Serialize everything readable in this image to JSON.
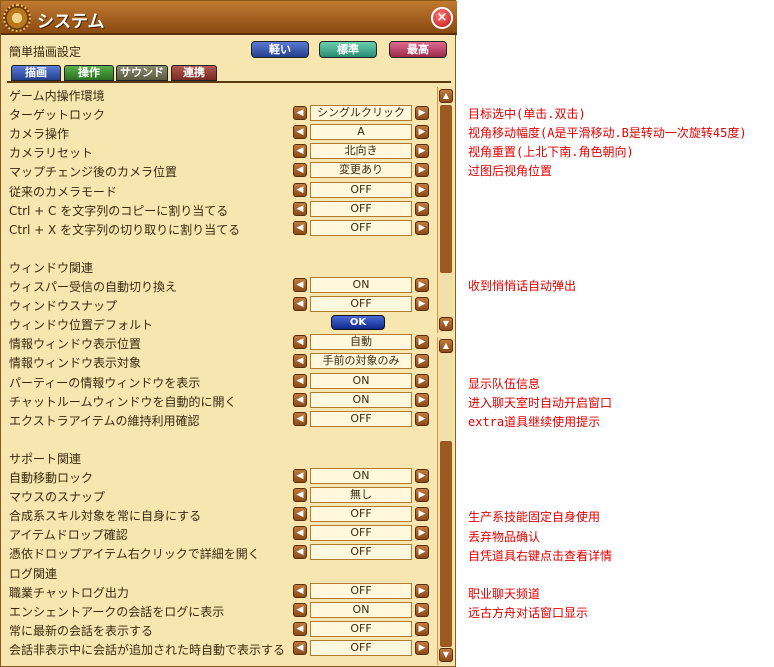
{
  "window": {
    "title": "システム",
    "close_glyph": "×",
    "quick_label": "簡単描画設定",
    "presets": [
      "軽い",
      "標準",
      "最高"
    ],
    "tabs": [
      "描画",
      "操作",
      "サウンド",
      "連携"
    ]
  },
  "rows": [
    {
      "type": "header",
      "label": "ゲーム内操作環境"
    },
    {
      "type": "select",
      "label": "ターゲットロック",
      "value": "シングルクリック"
    },
    {
      "type": "select",
      "label": "カメラ操作",
      "value": "A"
    },
    {
      "type": "select",
      "label": "カメラリセット",
      "value": "北向き"
    },
    {
      "type": "select",
      "label": "マップチェンジ後のカメラ位置",
      "value": "変更あり"
    },
    {
      "type": "select",
      "label": "従来のカメラモード",
      "value": "OFF"
    },
    {
      "type": "select",
      "label": "Ctrl + C を文字列のコピーに割り当てる",
      "value": "OFF"
    },
    {
      "type": "select",
      "label": "Ctrl + X を文字列の切り取りに割り当てる",
      "value": "OFF"
    },
    {
      "type": "blank"
    },
    {
      "type": "header",
      "label": "ウィンドウ関連"
    },
    {
      "type": "select",
      "label": "ウィスパー受信の自動切り換え",
      "value": "ON"
    },
    {
      "type": "select",
      "label": "ウィンドウスナップ",
      "value": "OFF"
    },
    {
      "type": "button",
      "label": "ウィンドウ位置デフォルト",
      "value": "OK"
    },
    {
      "type": "select",
      "label": "情報ウィンドウ表示位置",
      "value": "自動"
    },
    {
      "type": "select",
      "label": "情報ウィンドウ表示対象",
      "value": "手前の対象のみ"
    },
    {
      "type": "select",
      "label": "パーティーの情報ウィンドウを表示",
      "value": "ON"
    },
    {
      "type": "select",
      "label": "チャットルームウィンドウを自動的に開く",
      "value": "ON"
    },
    {
      "type": "select",
      "label": "エクストラアイテムの維持利用確認",
      "value": "OFF"
    },
    {
      "type": "blank"
    },
    {
      "type": "header",
      "label": "サポート関連"
    },
    {
      "type": "select",
      "label": "自動移動ロック",
      "value": "ON"
    },
    {
      "type": "select",
      "label": "マウスのスナップ",
      "value": "無し"
    },
    {
      "type": "select",
      "label": "合成系スキル対象を常に自身にする",
      "value": "OFF"
    },
    {
      "type": "select",
      "label": "アイテムドロップ確認",
      "value": "OFF"
    },
    {
      "type": "select",
      "label": "憑依ドロップアイテム右クリックで詳細を開く",
      "value": "OFF"
    },
    {
      "type": "header",
      "label": "ログ関連"
    },
    {
      "type": "select",
      "label": "職業チャットログ出力",
      "value": "OFF"
    },
    {
      "type": "select",
      "label": "エンシェントアークの会話をログに表示",
      "value": "ON"
    },
    {
      "type": "select",
      "label": "常に最新の会話を表示する",
      "value": "OFF"
    },
    {
      "type": "select",
      "label": "会話非表示中に会話が追加された時自動で表示する",
      "value": "OFF"
    }
  ],
  "notes": [
    "目标选中(单击.双击)",
    "视角移动幅度(A是平滑移动.B是转动一次旋转45度)",
    "视角重置(上北下南.角色朝向)",
    "过图后视角位置",
    "收到悄悄话自动弹出",
    "显示队伍信息",
    "进入聊天室时自动开启窗口",
    "extra道具继续使用提示",
    "生产系技能固定自身使用",
    "丢弃物品确认",
    "自凭道具右键点击查看详情",
    "职业聊天频道",
    "远古方舟对话窗口显示"
  ]
}
